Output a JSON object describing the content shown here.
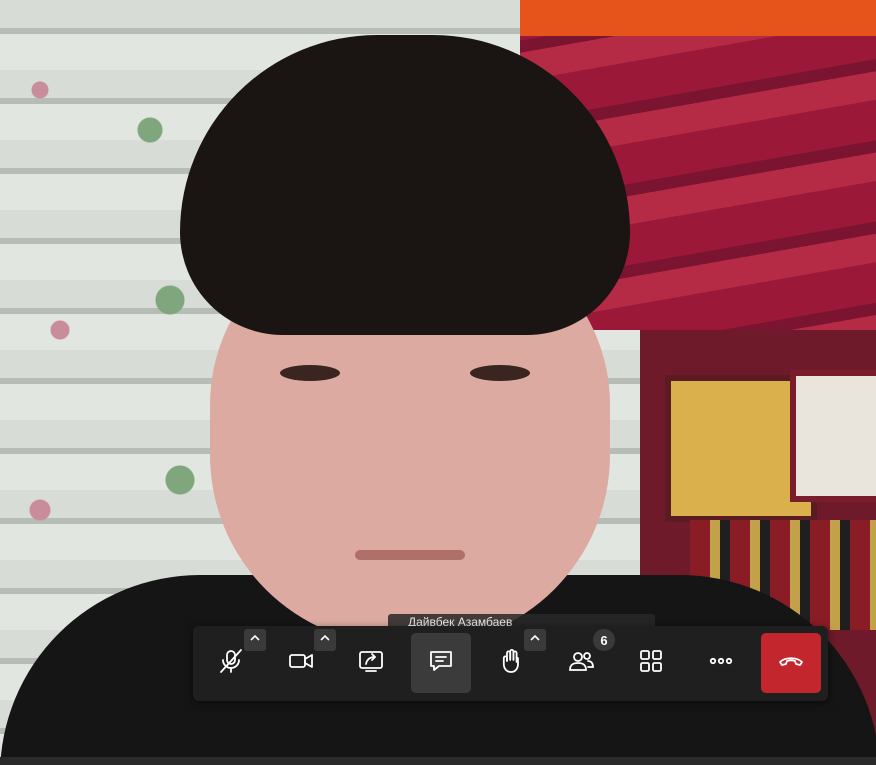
{
  "participant": {
    "name_tag": "Дайвбек Азамбаев"
  },
  "toolbar": {
    "buttons": [
      {
        "name": "mic-muted",
        "icon": "mic-off-icon"
      },
      {
        "name": "camera",
        "icon": "video-camera-icon"
      },
      {
        "name": "share-screen",
        "icon": "screen-share-icon"
      },
      {
        "name": "chat",
        "icon": "chat-bubble-icon",
        "active": true
      },
      {
        "name": "raise-hand",
        "icon": "hand-icon"
      },
      {
        "name": "participants",
        "icon": "people-icon",
        "count": "6"
      },
      {
        "name": "layout",
        "icon": "grid-icon"
      },
      {
        "name": "more",
        "icon": "ellipsis-icon"
      },
      {
        "name": "leave",
        "icon": "phone-hangup-icon"
      }
    ],
    "participants_count": "6"
  },
  "colors": {
    "toolbar_bg": "#1f1f1f",
    "active_bg": "#3b3b3b",
    "hangup_red": "#c4262e",
    "icon_white": "#ffffff"
  }
}
